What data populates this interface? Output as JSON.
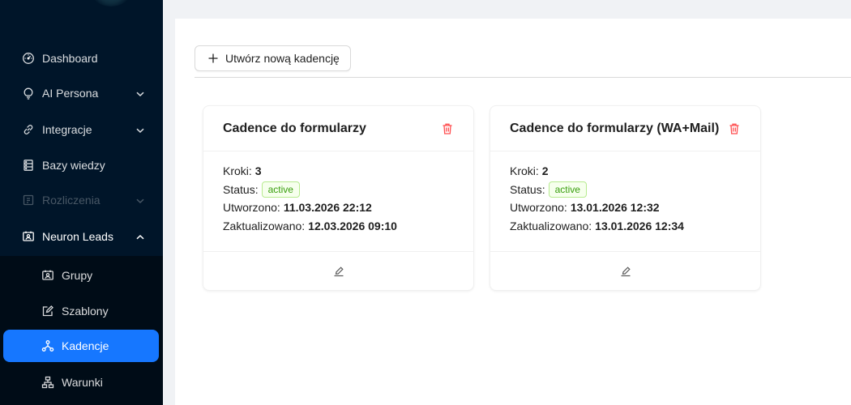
{
  "sidebar": {
    "items": [
      {
        "label": "Dashboard",
        "icon": "dashboard-icon"
      },
      {
        "label": "AI Persona",
        "icon": "bulb-icon",
        "has_chevron": true
      },
      {
        "label": "Integracje",
        "icon": "link-icon",
        "has_chevron": true
      },
      {
        "label": "Bazy wiedzy",
        "icon": "database-icon"
      },
      {
        "label": "Rozliczenia",
        "icon": "billing-icon",
        "has_chevron": true,
        "disabled": true
      },
      {
        "label": "Neuron Leads",
        "icon": "contacts-icon",
        "expanded": true
      }
    ],
    "subitems": [
      {
        "label": "Grupy",
        "icon": "group-icon"
      },
      {
        "label": "Szablony",
        "icon": "edit-square-icon"
      },
      {
        "label": "Kadencje",
        "icon": "cluster-icon",
        "selected": true
      },
      {
        "label": "Warunki",
        "icon": "partition-icon"
      }
    ]
  },
  "toolbar": {
    "create_label": "Utwórz nową kadencję"
  },
  "labels": {
    "steps": "Kroki:",
    "status": "Status:",
    "created": "Utworzono:",
    "updated": "Zaktualizowano:"
  },
  "cards": [
    {
      "title": "Cadence do formularzy",
      "steps": "3",
      "status": "active",
      "created": "11.03.2026 22:12",
      "updated": "12.03.2026 09:10"
    },
    {
      "title": "Cadence do formularzy (WA+Mail)",
      "steps": "2",
      "status": "active",
      "created": "13.01.2026 12:32",
      "updated": "13.01.2026 12:34"
    }
  ],
  "colors": {
    "sidebar_bg": "#001529",
    "submenu_bg": "#000c17",
    "selected_bg": "#1677ff",
    "delete_red": "#ff4d4f",
    "tag_green": "#389e0d"
  }
}
